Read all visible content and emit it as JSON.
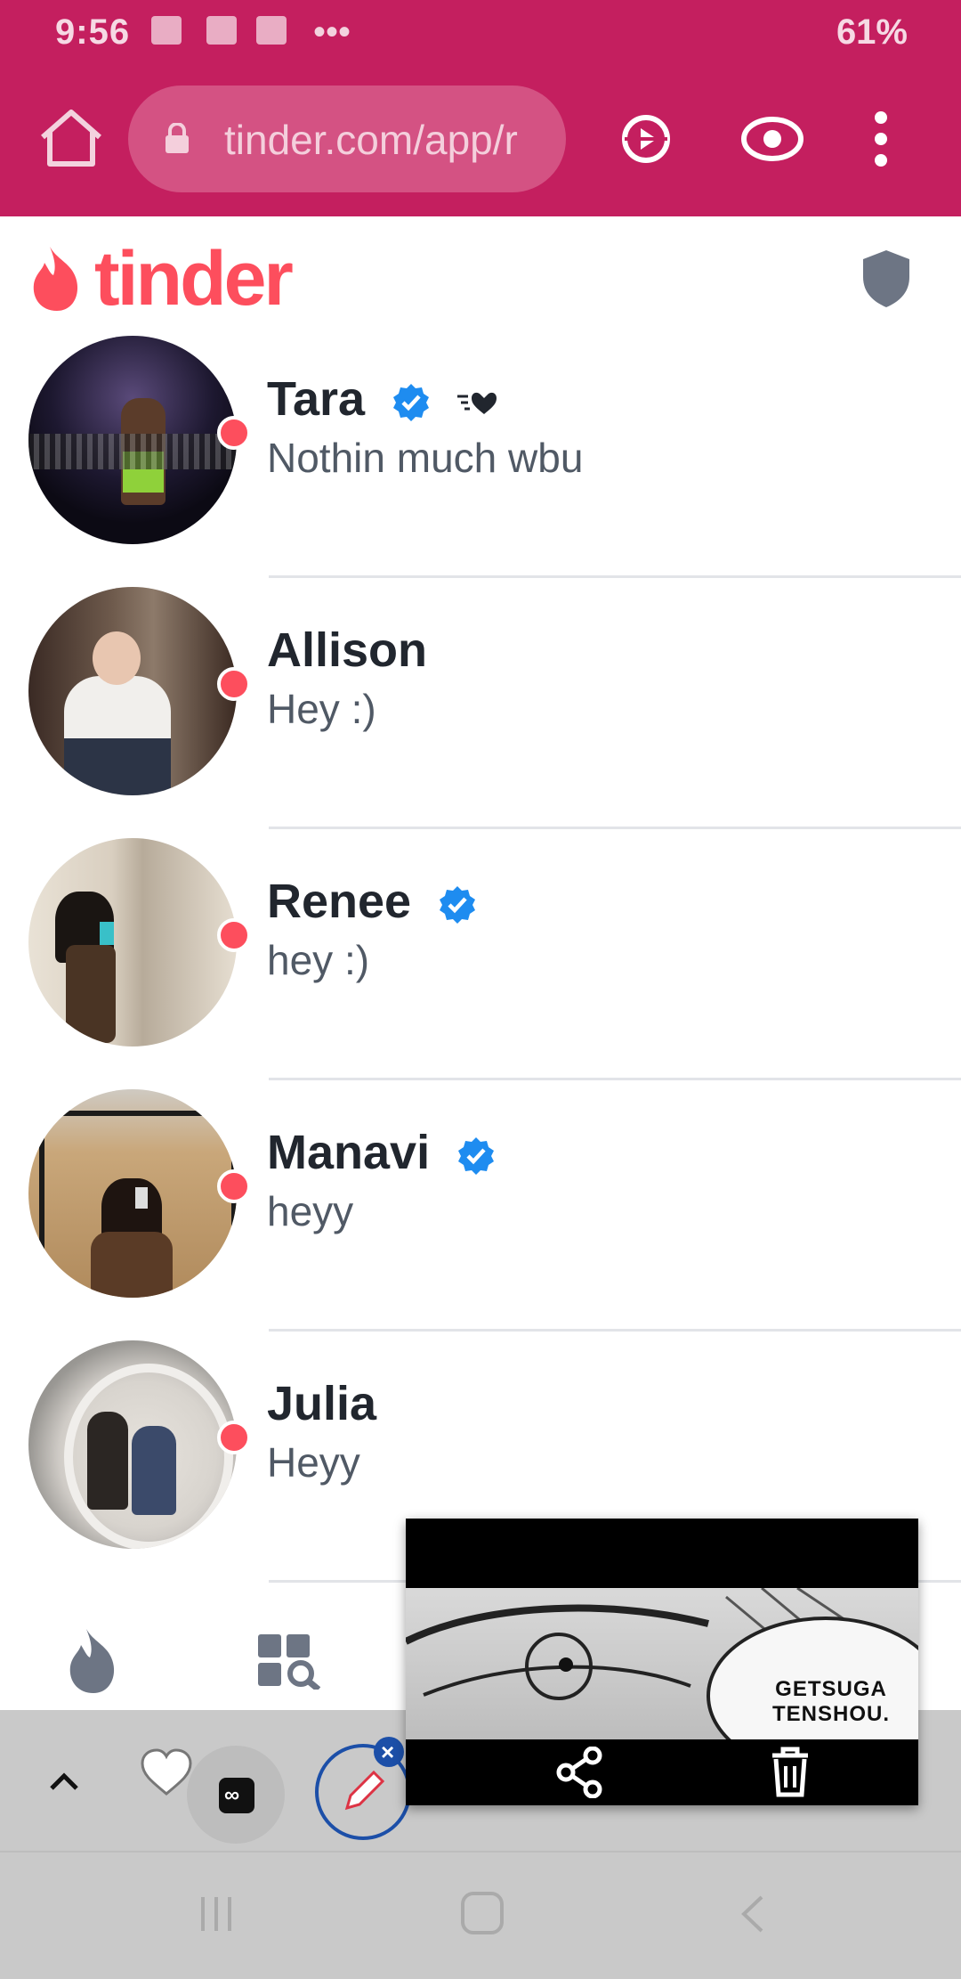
{
  "status_bar": {
    "time": "9:56",
    "battery": "61%"
  },
  "browser": {
    "url": "tinder.com/app/r"
  },
  "app": {
    "logo_text": "tinder"
  },
  "conversations": [
    {
      "name": "Tara",
      "message": "Nothin much wbu",
      "verified": true,
      "online": true
    },
    {
      "name": "Allison",
      "message": "Hey :)",
      "verified": false,
      "online": true
    },
    {
      "name": "Renee",
      "message": "hey :)",
      "verified": true,
      "online": true
    },
    {
      "name": "Manavi",
      "message": "heyy",
      "verified": true,
      "online": true
    },
    {
      "name": "Julia",
      "message": "Heyy",
      "verified": false,
      "online": true
    }
  ],
  "overlay": {
    "bubble_text_line1": "GETSUGA",
    "bubble_text_line2": "TENSHOU."
  },
  "colors": {
    "browser_bar": "#c41f5f",
    "brand": "#fd4e5d",
    "verified": "#1e8cf0"
  }
}
